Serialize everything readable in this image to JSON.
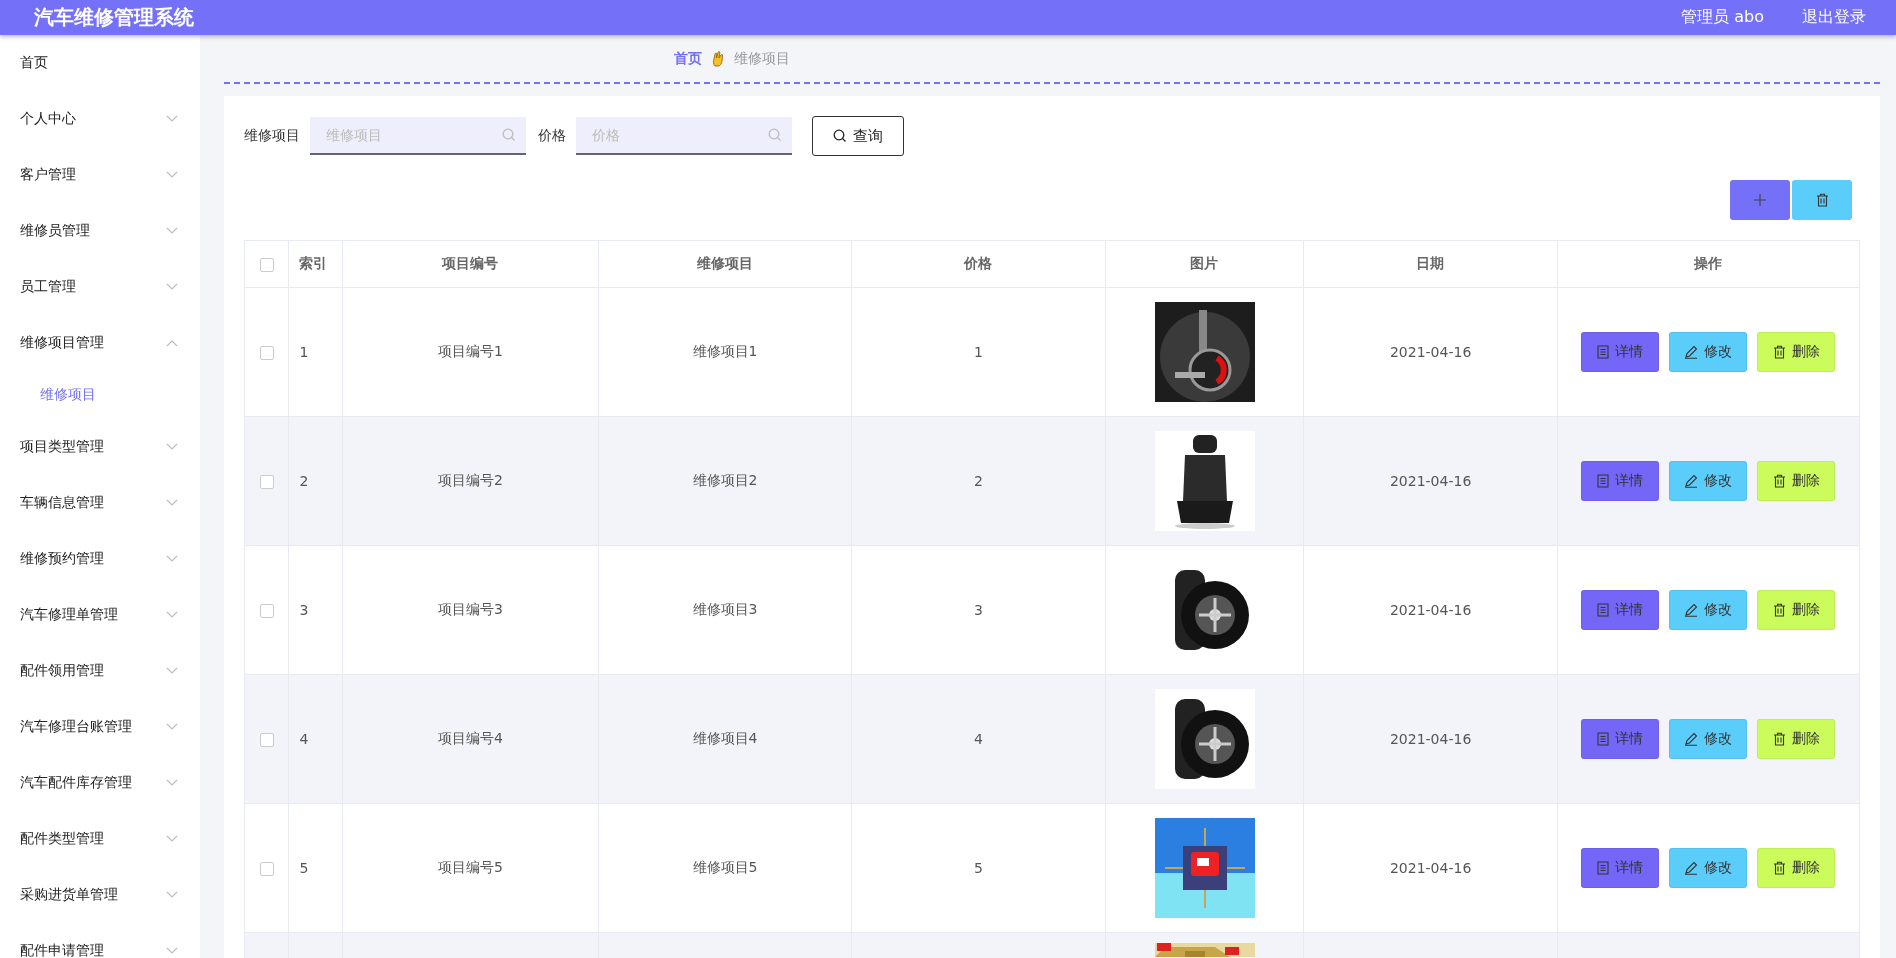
{
  "header": {
    "title": "汽车维修管理系统",
    "user": "管理员 abo",
    "logout": "退出登录"
  },
  "sidebar": {
    "items": [
      {
        "label": "首页",
        "kind": "link"
      },
      {
        "label": "个人中心",
        "kind": "menu",
        "expanded": false
      },
      {
        "label": "客户管理",
        "kind": "menu",
        "expanded": false
      },
      {
        "label": "维修员管理",
        "kind": "menu",
        "expanded": false
      },
      {
        "label": "员工管理",
        "kind": "menu",
        "expanded": false
      },
      {
        "label": "维修项目管理",
        "kind": "menu",
        "expanded": true,
        "children": [
          {
            "label": "维修项目",
            "selected": true
          }
        ]
      },
      {
        "label": "项目类型管理",
        "kind": "menu",
        "expanded": false
      },
      {
        "label": "车辆信息管理",
        "kind": "menu",
        "expanded": false
      },
      {
        "label": "维修预约管理",
        "kind": "menu",
        "expanded": false
      },
      {
        "label": "汽车修理单管理",
        "kind": "menu",
        "expanded": false
      },
      {
        "label": "配件领用管理",
        "kind": "menu",
        "expanded": false
      },
      {
        "label": "汽车修理台账管理",
        "kind": "menu",
        "expanded": false
      },
      {
        "label": "汽车配件库存管理",
        "kind": "menu",
        "expanded": false
      },
      {
        "label": "配件类型管理",
        "kind": "menu",
        "expanded": false
      },
      {
        "label": "采购进货单管理",
        "kind": "menu",
        "expanded": false
      },
      {
        "label": "配件申请管理",
        "kind": "menu",
        "expanded": false
      }
    ]
  },
  "breadcrumb": [
    "首页",
    "维修项目"
  ],
  "search": {
    "fields": [
      {
        "label": "维修项目",
        "placeholder": "维修项目"
      },
      {
        "label": "价格",
        "placeholder": "价格"
      }
    ],
    "button": "查询"
  },
  "table": {
    "columns": [
      "索引",
      "项目编号",
      "维修项目",
      "价格",
      "图片",
      "日期",
      "操作"
    ],
    "rows": [
      {
        "checked": false,
        "index": "1",
        "code": "项目编号1",
        "name": "维修项目1",
        "price": "1",
        "date": "2021-04-16",
        "actions": [
          "详情",
          "修改",
          "删除"
        ]
      },
      {
        "checked": false,
        "index": "2",
        "code": "项目编号2",
        "name": "维修项目2",
        "price": "2",
        "date": "2021-04-16",
        "actions": [
          "详情",
          "修改",
          "删除"
        ]
      },
      {
        "checked": false,
        "index": "3",
        "code": "项目编号3",
        "name": "维修项目3",
        "price": "3",
        "date": "2021-04-16",
        "actions": [
          "详情",
          "修改",
          "删除"
        ]
      },
      {
        "checked": false,
        "index": "4",
        "code": "项目编号4",
        "name": "维修项目4",
        "price": "4",
        "date": "2021-04-16",
        "actions": [
          "详情",
          "修改",
          "删除"
        ]
      },
      {
        "checked": false,
        "index": "5",
        "code": "项目编号5",
        "name": "维修项目5",
        "price": "5",
        "date": "2021-04-16",
        "actions": [
          "详情",
          "修改",
          "删除"
        ]
      }
    ],
    "select_all": {
      "checked": false
    }
  }
}
